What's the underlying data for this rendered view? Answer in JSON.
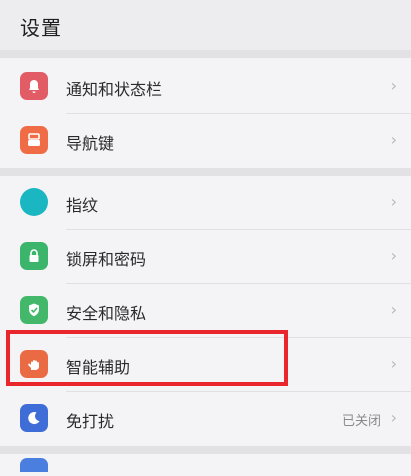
{
  "header": {
    "title": "设置"
  },
  "items": [
    {
      "key": "notifications",
      "label": "通知和状态栏",
      "value": "",
      "color": "#e25c66",
      "icon": "bell-icon"
    },
    {
      "key": "navigation",
      "label": "导航键",
      "value": "",
      "color": "#ef6c47",
      "icon": "navigation-key-icon"
    },
    {
      "key": "fingerprint",
      "label": "指纹",
      "value": "",
      "color": "#1ab7c2",
      "icon": "fingerprint-icon"
    },
    {
      "key": "lockscreen",
      "label": "锁屏和密码",
      "value": "",
      "color": "#3ab56b",
      "icon": "lock-icon"
    },
    {
      "key": "security",
      "label": "安全和隐私",
      "value": "",
      "color": "#43b86b",
      "icon": "shield-icon"
    },
    {
      "key": "assist",
      "label": "智能辅助",
      "value": "",
      "color": "#ea6a44",
      "icon": "hand-icon"
    },
    {
      "key": "dnd",
      "label": "免打扰",
      "value": "已关闭",
      "color": "#3f6dd8",
      "icon": "moon-icon"
    }
  ]
}
